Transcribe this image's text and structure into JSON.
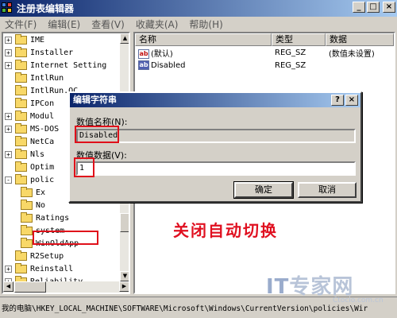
{
  "window": {
    "title": "注册表编辑器",
    "min": "_",
    "max": "□",
    "close": "×"
  },
  "menu": [
    "文件(F)",
    "编辑(E)",
    "查看(V)",
    "收藏夹(A)",
    "帮助(H)"
  ],
  "tree": {
    "items": [
      {
        "label": "IME",
        "expander": "+"
      },
      {
        "label": "Installer",
        "expander": "+"
      },
      {
        "label": "Internet Setting",
        "expander": "+"
      },
      {
        "label": "IntlRun",
        "expander": ""
      },
      {
        "label": "IntlRun.OC",
        "expander": ""
      },
      {
        "label": "IPCon",
        "expander": ""
      },
      {
        "label": "Modul",
        "expander": "+"
      },
      {
        "label": "MS-DOS",
        "expander": "+"
      },
      {
        "label": "NetCa",
        "expander": ""
      },
      {
        "label": "Nls",
        "expander": "+"
      },
      {
        "label": "Optim",
        "expander": ""
      },
      {
        "label": "polic",
        "expander": "-"
      },
      {
        "label": "Ex",
        "expander": ""
      },
      {
        "label": "No",
        "expander": ""
      },
      {
        "label": "Ratings",
        "expander": ""
      },
      {
        "label": "system",
        "expander": ""
      },
      {
        "label": "WinOldApp",
        "expander": ""
      },
      {
        "label": "R2Setup",
        "expander": ""
      },
      {
        "label": "Reinstall",
        "expander": "+"
      },
      {
        "label": "Reliability",
        "expander": "+"
      },
      {
        "label": "...",
        "expander": "+"
      }
    ]
  },
  "list": {
    "headers": [
      "名称",
      "类型",
      "数据"
    ],
    "rows": [
      {
        "name": "(默认)",
        "type": "REG_SZ",
        "data": "(数值未设置)",
        "icon": "ab"
      },
      {
        "name": "Disabled",
        "type": "REG_SZ",
        "data": "",
        "icon": "ab-bin"
      }
    ]
  },
  "dialog": {
    "title": "编辑字符串",
    "help": "?",
    "close": "×",
    "name_label": "数值名称(N):",
    "name_value": "Disabled",
    "data_label": "数值数据(V):",
    "data_value": "1",
    "ok": "确定",
    "cancel": "取消"
  },
  "status": "我的电脑\\HKEY_LOCAL_MACHINE\\SOFTWARE\\Microsoft\\Windows\\CurrentVersion\\policies\\Wir",
  "annotation": "关闭自动切换",
  "watermark": {
    "main_it": "IT",
    "main_rest": "专家网",
    "sub": "Ctocio.com.cn"
  },
  "colors": {
    "accent": "#0a246a",
    "highlight": "#e0101a"
  }
}
